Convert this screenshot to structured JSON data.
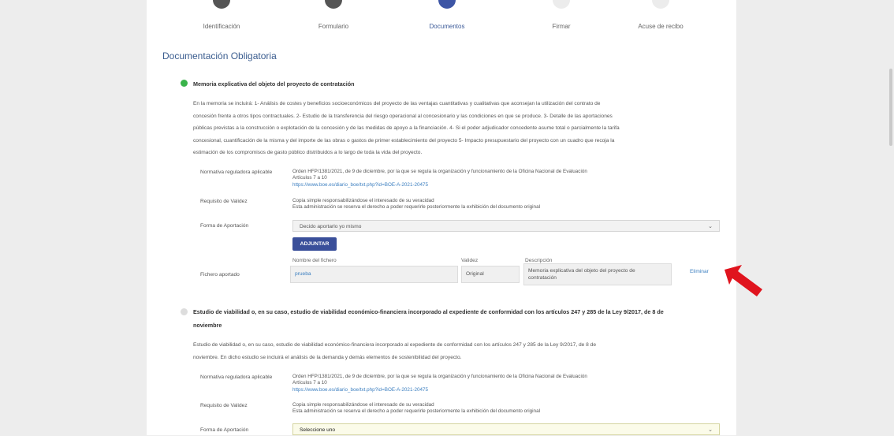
{
  "stepper": {
    "steps": [
      {
        "label": "Identificación",
        "state": "done"
      },
      {
        "label": "Formulario",
        "state": "done"
      },
      {
        "label": "Documentos",
        "state": "active"
      },
      {
        "label": "Firmar",
        "state": "pending"
      },
      {
        "label": "Acuse de recibo",
        "state": "pending"
      }
    ]
  },
  "section": {
    "title": "Documentación Obligatoria"
  },
  "doc1": {
    "title": "Memoria explicativa del objeto del proyecto de contratación",
    "status_color": "#39b34a",
    "description": [
      "En la memoria se incluirá: 1- Análisis de costes y beneficios socioeconómicos del proyecto de las ventajas cuantitativas y cualitativas que aconsejan la utilización del contrato de",
      "concesión frente a otros tipos contractuales. 2- Estudio de la transferencia del riesgo operacional al concesionario y las condiciones en que se produce. 3- Detalle de las aportaciones",
      "públicas previstas a la construcción o explotación de la concesión y de las medidas de apoyo a la financiación. 4- Si el poder adjudicador concedente asume total o parcialmente la tarifa",
      "concesional, cuantificación de la misma y del importe de las obras o gastos de primer establecimiento del proyecto 5- Impacto presupuestario del proyecto con un cuadro que recoja la",
      "estimación de los compromisos de gasto público distribuidos a lo largo de toda la vida del proyecto."
    ],
    "normativa_label": "Normativa reguladora aplicable",
    "normativa_lines": [
      "Orden HFP/1381/2021, de 9 de diciembre, por la que se regula la organización y funcionamiento de la Oficina Nacional de Evaluación",
      "Artículos 7 a 10"
    ],
    "normativa_link": "https://www.boe.es/diario_boe/txt.php?id=BOE-A-2021-20475",
    "requisito_label": "Requisito de Validez",
    "requisito_lines": [
      "Copia simple responsabilizándose el interesado de su veracidad",
      "Esta administración se reserva el derecho a poder requerirle posteriormente la exhibición del documento original"
    ],
    "forma_label": "Forma de Aportación",
    "forma_value": "Decido aportarlo yo mismo",
    "adjuntar_label": "ADJUNTAR",
    "fichero_label": "Fichero aportado",
    "col_nombre": "Nombre del fichero",
    "col_validez": "Validez",
    "col_descripcion": "Descripción",
    "file_name": "prueba",
    "file_validez": "Original",
    "file_descripcion": "Memoria explicativa del objeto del proyecto de contratación",
    "eliminar_label": "Eliminar"
  },
  "doc2": {
    "title_lines": [
      "Estudio de viabilidad o, en su caso, estudio de viabilidad económico-financiera incorporado al expediente de conformidad con los artículos 247 y 285 de la Ley 9/2017, de 8 de",
      "noviembre"
    ],
    "status_color": "#dddddd",
    "description": [
      "Estudio de viabilidad o, en su caso, estudio de viabilidad económico-financiera incorporado al expediente de conformidad con los artículos 247 y 285 de la Ley 9/2017, de 8 de",
      "noviembre. En dicho estudio se incluirá el análisis de la demanda y demás elementos de sostenibilidad del proyecto."
    ],
    "normativa_label": "Normativa reguladora aplicable",
    "normativa_lines": [
      "Orden HFP/1381/2021, de 9 de diciembre, por la que se regula la organización y funcionamiento de la Oficina Nacional de Evaluación",
      "Artículos 7 a 10"
    ],
    "normativa_link": "https://www.boe.es/diario_boe/txt.php?id=BOE-A-2021-20475",
    "requisito_label": "Requisito de Validez",
    "requisito_lines": [
      "Copia simple responsabilizándose el interesado de su veracidad",
      "Esta administración se reserva el derecho a poder requerirle posteriormente la exhibición del documento original"
    ],
    "forma_label": "Forma de Aportación",
    "forma_value": "Seleccione uno"
  },
  "colors": {
    "accent": "#3a4f9a",
    "arrow": "#e0141e",
    "done_step": "#555555",
    "active_step": "#3d55a5",
    "pending_step": "#e8e8e8"
  }
}
